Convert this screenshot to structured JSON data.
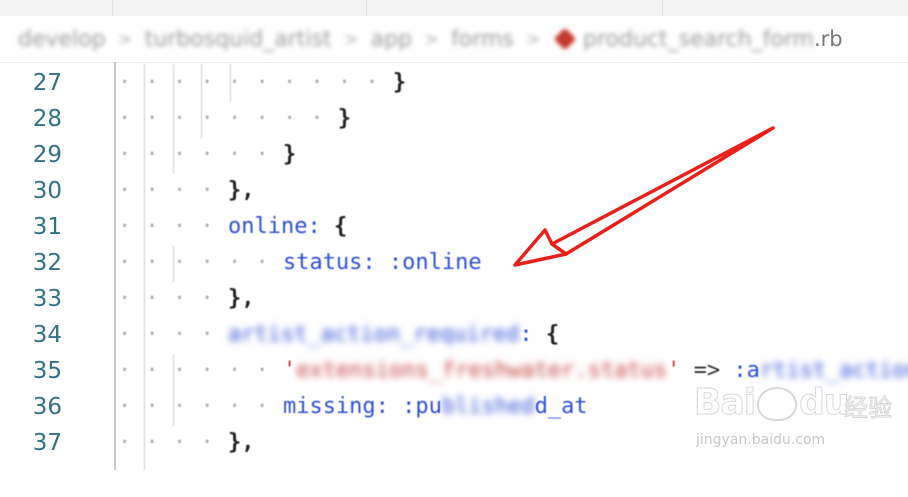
{
  "breadcrumb": {
    "segments": [
      "develop",
      "turbosquid_artist",
      "app",
      "forms"
    ],
    "separator": ">",
    "file_stem": "product_search_form",
    "file_ext": ".rb"
  },
  "editor": {
    "line_numbers": [
      "27",
      "28",
      "29",
      "30",
      "31",
      "32",
      "33",
      "34",
      "35",
      "36",
      "37"
    ],
    "lines": {
      "l27": {
        "close": "}"
      },
      "l28": {
        "close": "}"
      },
      "l29": {
        "close": "}"
      },
      "l30": {
        "close": "},"
      },
      "l31": {
        "key": "online:",
        "open": "{"
      },
      "l32": {
        "key": "status:",
        "value": ":online"
      },
      "l33": {
        "close": "},"
      },
      "l34": {
        "key": "artist_action_required",
        "colon": ":",
        "open": "{"
      },
      "l35": {
        "quote_open": "'",
        "string": "extensions_freshwater.status",
        "quote_close": "'",
        "hash_rocket": "=>",
        "value_visible": ":a",
        "value_hidden": "rtist_action",
        "value_tail": "n_"
      },
      "l36": {
        "key": "missing:",
        "value_prefix": ":pu",
        "value_hidden": "blished",
        "value_suffix": "d_at"
      },
      "l37": {
        "close": "},"
      }
    }
  },
  "colors": {
    "line_number": "#347085",
    "key": "#2f4fd6",
    "string": "#c23b3b",
    "annotation_arrow": "#e8201a"
  },
  "watermark": {
    "brand": "Baidu",
    "chinese": "经验",
    "url": "jingyan.baidu.com"
  }
}
